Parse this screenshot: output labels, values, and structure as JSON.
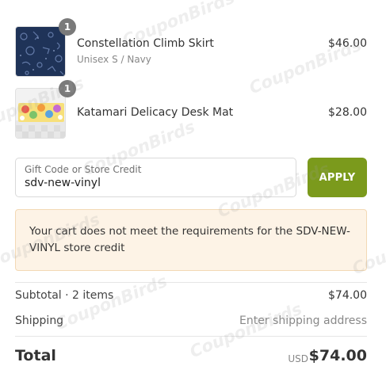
{
  "items": [
    {
      "name": "Constellation Climb Skirt",
      "variant": "Unisex S / Navy",
      "price": "$46.00",
      "quantity": "1",
      "thumbnail": "navy-patterned-fabric"
    },
    {
      "name": "Katamari Delicacy Desk Mat",
      "variant": "",
      "price": "$28.00",
      "quantity": "1",
      "thumbnail": "colorful-food-desk-mat"
    }
  ],
  "discount": {
    "label": "Gift Code or Store Credit",
    "value": "sdv-new-vinyl",
    "apply_label": "APPLY"
  },
  "error_message": "Your cart does not meet the requirements for the SDV-NEW-VINYL store credit",
  "summary": {
    "subtotal_label": "Subtotal · 2 items",
    "subtotal_value": "$74.00",
    "shipping_label": "Shipping",
    "shipping_value": "Enter shipping address",
    "total_label": "Total",
    "total_currency": "USD",
    "total_value": "$74.00"
  },
  "watermark_text": "CouponBirds",
  "colors": {
    "apply_button": "#7b9a1c",
    "error_background": "#fdf3e6",
    "error_border": "#f3d9b5",
    "quantity_badge": "#7a7a7a"
  }
}
